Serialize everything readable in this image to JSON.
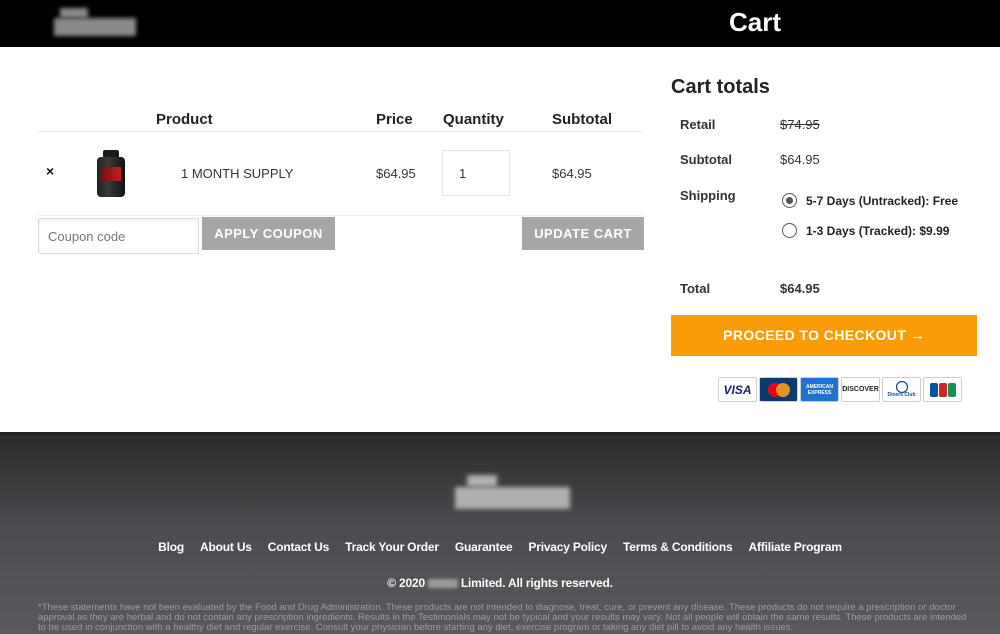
{
  "header": {
    "title": "Cart"
  },
  "cart_table": {
    "columns": [
      "Product",
      "Price",
      "Quantity",
      "Subtotal"
    ],
    "row": {
      "remove": "×",
      "product_name": "1 MONTH SUPPLY",
      "price": "$64.95",
      "quantity": "1",
      "subtotal": "$64.95"
    },
    "coupon_placeholder": "Coupon code",
    "apply_coupon_label": "APPLY COUPON",
    "update_cart_label": "UPDATE CART"
  },
  "cart_totals": {
    "title": "Cart totals",
    "retail_label": "Retail",
    "retail_value": "$74.95",
    "subtotal_label": "Subtotal",
    "subtotal_value": "$64.95",
    "shipping_label": "Shipping",
    "shipping_options": [
      {
        "label": "5-7 Days (Untracked): Free",
        "selected": true
      },
      {
        "label": "1-3 Days (Tracked): $9.99",
        "selected": false
      }
    ],
    "total_label": "Total",
    "total_value": "$64.95",
    "checkout_label": "PROCEED TO CHECKOUT →"
  },
  "payment_icons": [
    "visa-icon",
    "mastercard-icon",
    "amex-icon",
    "discover-icon",
    "diners-club-icon",
    "jcb-icon"
  ],
  "payment_icon_text": {
    "visa": "VISA",
    "mastercard": "MasterCard",
    "amex": "AMERICAN EXPRESS",
    "discover": "DISCOVER",
    "diners": "Diners Club",
    "jcb": "JCB"
  },
  "footer": {
    "nav": [
      "Blog",
      "About Us",
      "Contact Us",
      "Track Your Order",
      "Guarantee",
      "Privacy Policy",
      "Terms & Conditions",
      "Affiliate Program"
    ],
    "copyright_prefix": "© 2020",
    "copyright_suffix": "Limited. All rights reserved.",
    "disclaimer": "*These statements have not been evaluated by the Food and Drug Administration. These products are not intended to diagnose, treat, cure, or prevent any disease. These products do not require a prescription or doctor approval as they are herbal and do not contain any prescription ingredients. Results in the Testimonials may not be typical and your results may vary. Not all people will obtain the same results. These products are intended to be used in conjunction with a healthy diet and regular exercise. Consult your physician before starting any diet, exercise program or taking any diet pill to avoid any health issues."
  },
  "colors": {
    "header_bg": "#000000",
    "checkout_orange": "#fa9b0a",
    "button_grey": "#a6a6a6",
    "footer_bg": "#4b4b4f"
  }
}
